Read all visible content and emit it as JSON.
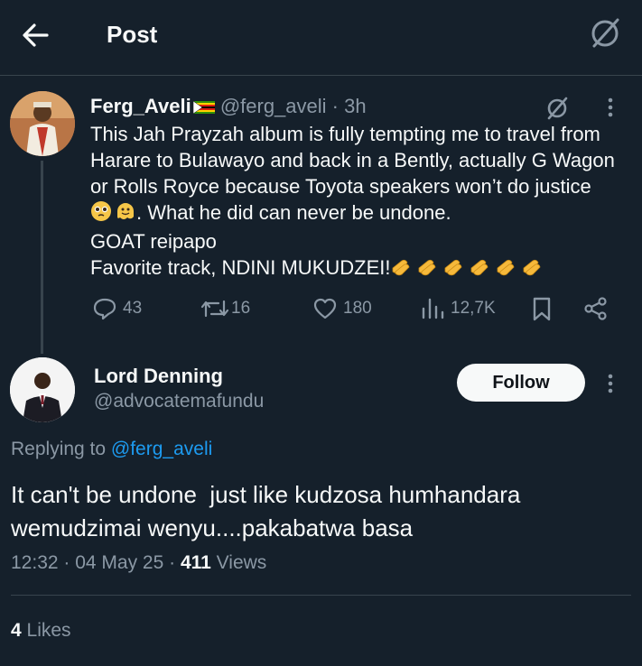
{
  "header": {
    "title": "Post"
  },
  "parent": {
    "name": "Ferg_Aveli",
    "handle": "@ferg_aveli",
    "time": "· 3h",
    "lines": [
      "This Jah Prayzah album is fully tempting me to travel from",
      "Harare to Bulawayo and back in a Bently, actually G Wagon",
      "or Rolls Royce because Toyota speakers won’t do justice",
      ". What he did can never be undone.",
      "GOAT reipapo",
      "Favorite track, NDINI MUKUDZEI!"
    ],
    "stats": {
      "replies": "43",
      "reposts": "16",
      "likes": "180",
      "views": "12,7K"
    }
  },
  "reply": {
    "name": "Lord Denning",
    "handle": "@advocatemafundu",
    "follow_label": "Follow",
    "replying_prefix": "Replying to",
    "replying_to": "@ferg_aveli",
    "text_line1": "It can't be undone  just like kudzosa humhandara",
    "text_line2": "wemudzimai wenyu....pakabatwa basa",
    "time": "12:32 · 04 May 25 · ",
    "views_count": "411",
    "views_label": " Views",
    "likes_count": "4",
    "likes_label": " Likes"
  },
  "colors": {
    "background": "#15202b",
    "text": "#f7f9f9",
    "muted": "#8b98a5",
    "accent": "#1d9bf0",
    "border": "#38444d"
  }
}
